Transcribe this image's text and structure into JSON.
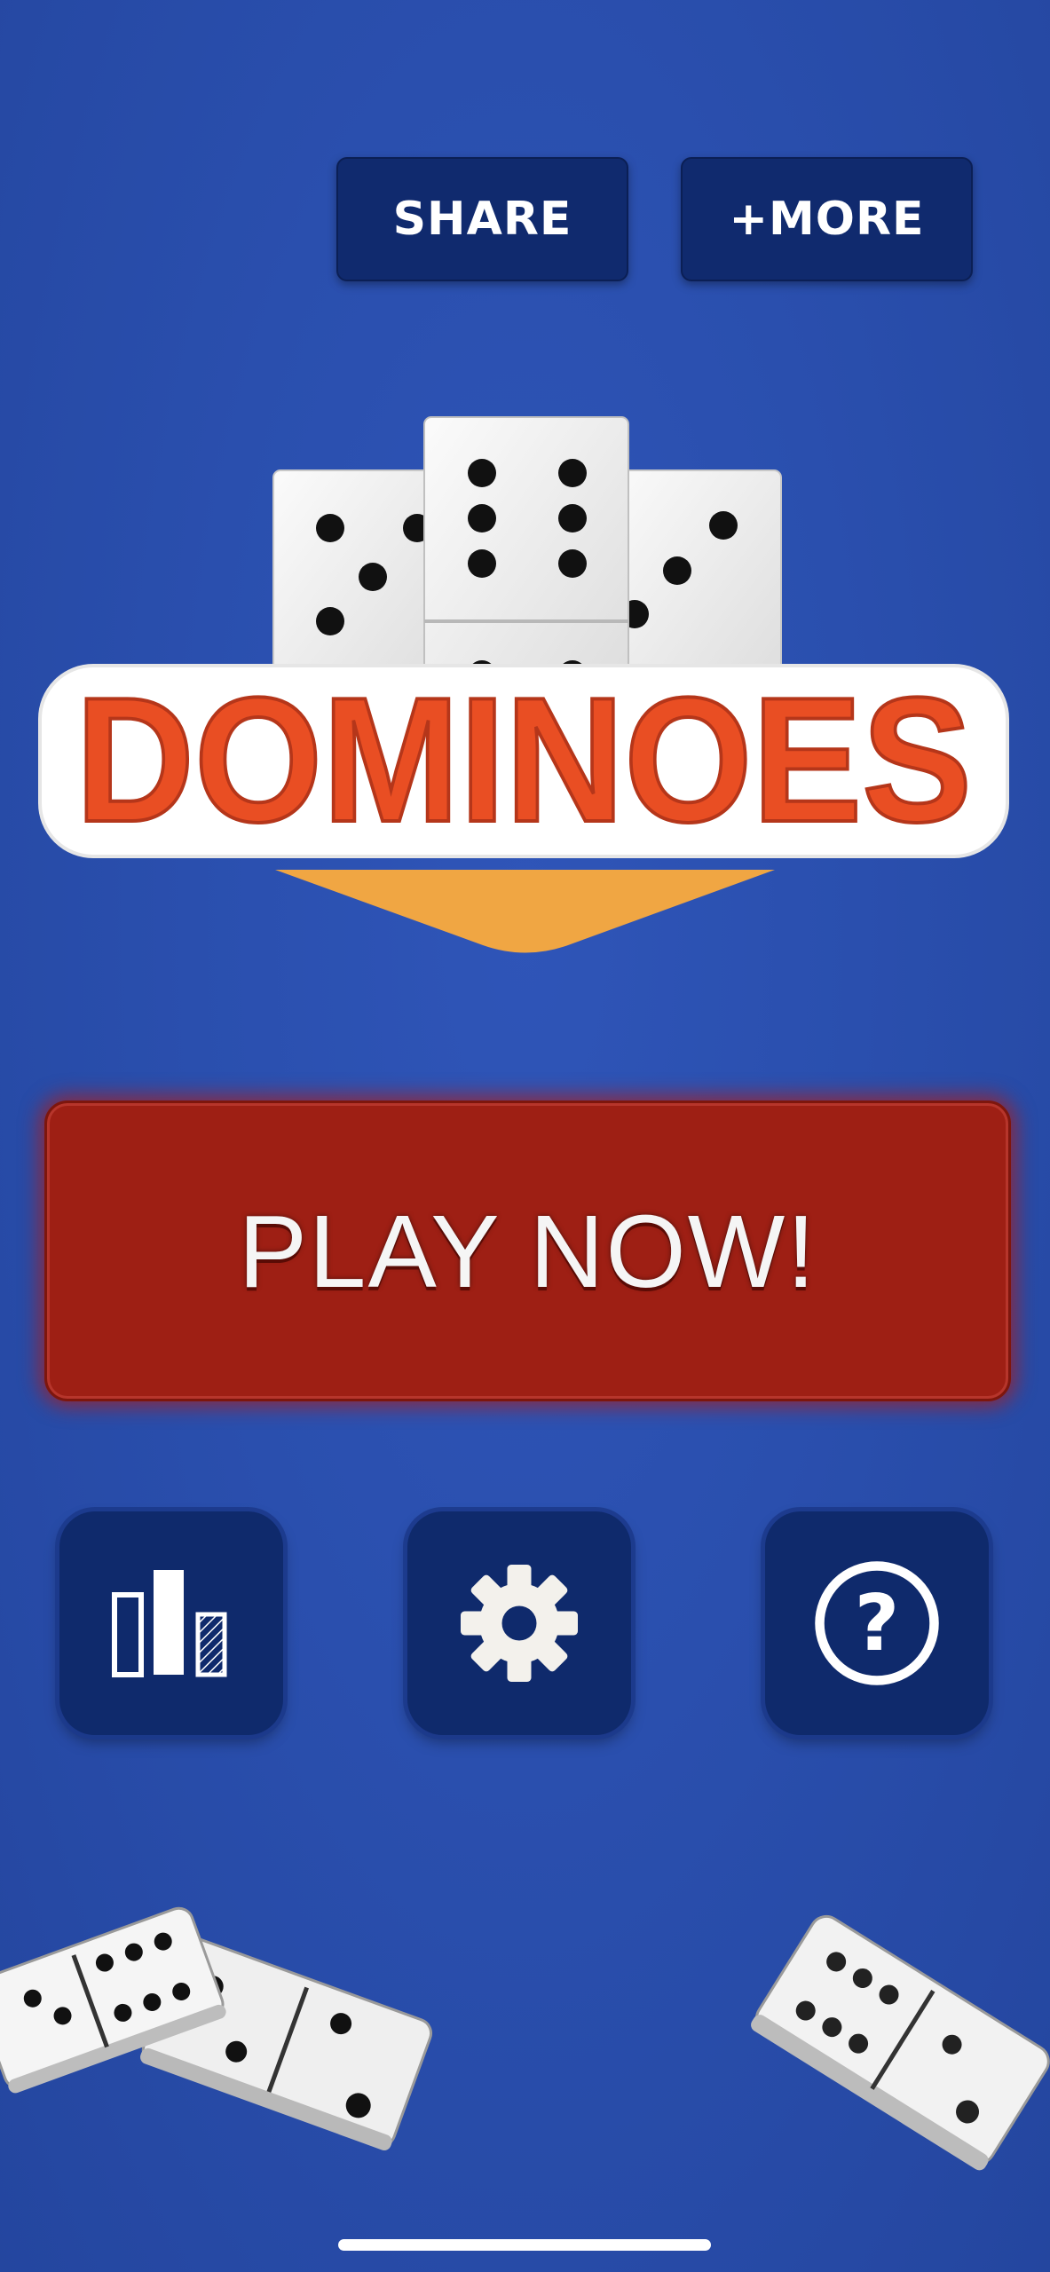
{
  "header": {
    "share_label": "SHARE",
    "more_label": "+MORE"
  },
  "logo": {
    "title": "DOMINOES",
    "title_color": "#e94e23",
    "ribbon_color": "#f0a643"
  },
  "main": {
    "play_label": "PLAY NOW!",
    "play_color": "#9e1f14"
  },
  "icon_buttons": [
    {
      "icon": "leaderboard-icon"
    },
    {
      "icon": "gear-icon"
    },
    {
      "icon": "help-icon"
    }
  ],
  "colors": {
    "background": "#2a4fae",
    "button_dark": "#102a6e"
  }
}
